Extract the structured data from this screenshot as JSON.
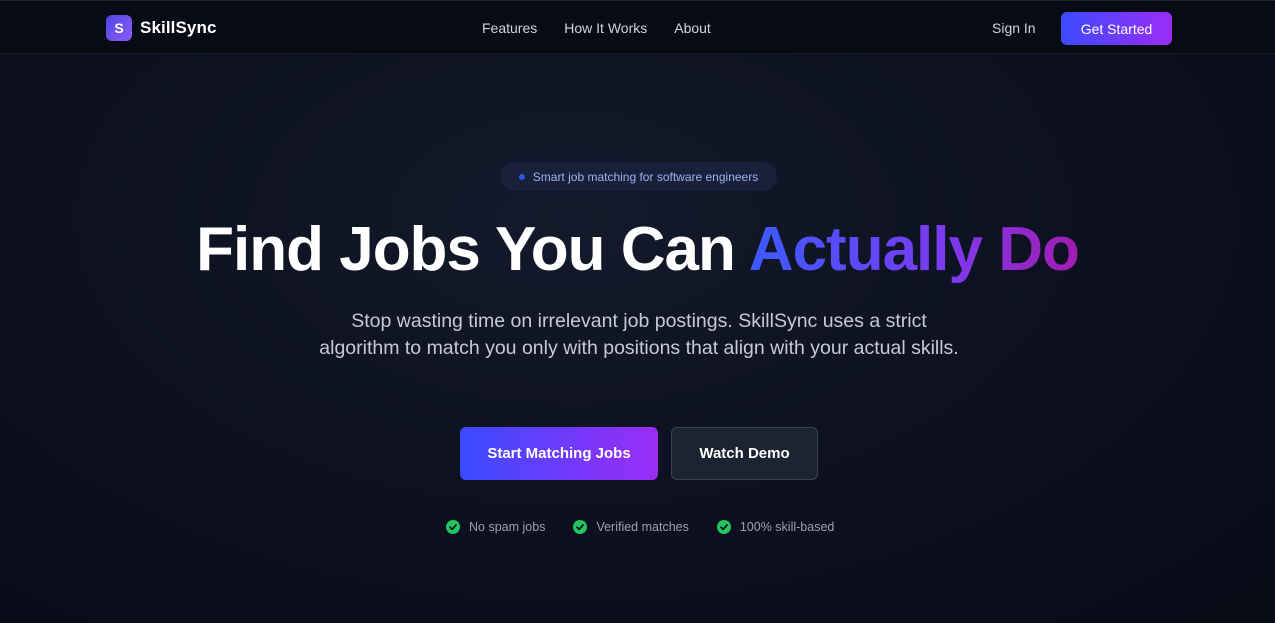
{
  "nav": {
    "brand_initial": "S",
    "brand_name": "SkillSync",
    "links": [
      "Features",
      "How It Works",
      "About"
    ],
    "sign_in": "Sign In",
    "get_started": "Get Started"
  },
  "hero": {
    "pill_text": "Smart job matching for software engineers",
    "headline_plain": "Find Jobs You Can ",
    "headline_accent": "Actually Do",
    "subtext": "Stop wasting time on irrelevant job postings. SkillSync uses a strict algorithm to match you only with positions that align with your actual skills.",
    "primary_cta": "Start Matching Jobs",
    "secondary_cta": "Watch Demo",
    "features": [
      "No spam jobs",
      "Verified matches",
      "100% skill-based"
    ]
  },
  "colors": {
    "background": "#0c1020",
    "accent_start": "#3b4bff",
    "accent_end": "#9b2cf5",
    "check_green": "#22c55e"
  },
  "icons": {
    "logo": "logo-icon",
    "pill_dot": "dot-icon",
    "feature_check": "check-circle-icon"
  }
}
